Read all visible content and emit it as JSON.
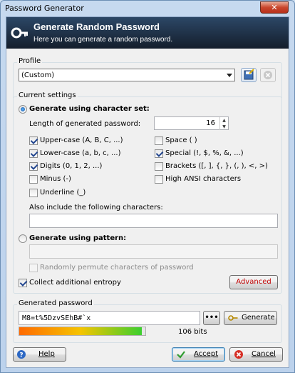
{
  "window": {
    "title": "Password Generator",
    "close_label": "✕"
  },
  "banner": {
    "title": "Generate Random Password",
    "subtitle": "Here you can generate a random password."
  },
  "profile": {
    "group_label": "Profile",
    "selected": "(Custom)"
  },
  "settings": {
    "group_label": "Current settings",
    "charset_radio_label": "Generate using character set:",
    "length_label": "Length of generated password:",
    "length_value": "16",
    "checkboxes": [
      {
        "label": "Upper-case (A, B, C, ...)",
        "checked": true
      },
      {
        "label": "Space ( )",
        "checked": false
      },
      {
        "label": "Lower-case (a, b, c, ...)",
        "checked": true
      },
      {
        "label": "Special (!, $, %, &, ...)",
        "checked": true
      },
      {
        "label": "Digits (0, 1, 2, ...)",
        "checked": true
      },
      {
        "label": "Brackets ([, ], {, }, (, ), <, >)",
        "checked": false
      },
      {
        "label": "Minus (-)",
        "checked": false
      },
      {
        "label": "High ANSI characters",
        "checked": false
      },
      {
        "label": "Underline (_)",
        "checked": false
      }
    ],
    "also_include_label": "Also include the following characters:",
    "also_include_value": "",
    "pattern_radio_label": "Generate using pattern:",
    "pattern_value": "",
    "permute_label": "Randomly permute characters of password",
    "collect_entropy_label": "Collect additional entropy",
    "advanced_label": "Advanced"
  },
  "generated": {
    "group_label": "Generated password",
    "password": "M8=t%5DzvSEhB#`x",
    "reveal_label": "•••",
    "generate_label": "Generate",
    "quality_fraction": 0.97,
    "bits_label": "106 bits"
  },
  "footer": {
    "help_label": "Help",
    "accept_label": "Accept",
    "cancel_label": "Cancel"
  },
  "colors": {
    "banner_top": "#2c4766",
    "accent": "#3c7fb1",
    "quality_low": "#ff6a00",
    "quality_high": "#3ccf2f"
  }
}
